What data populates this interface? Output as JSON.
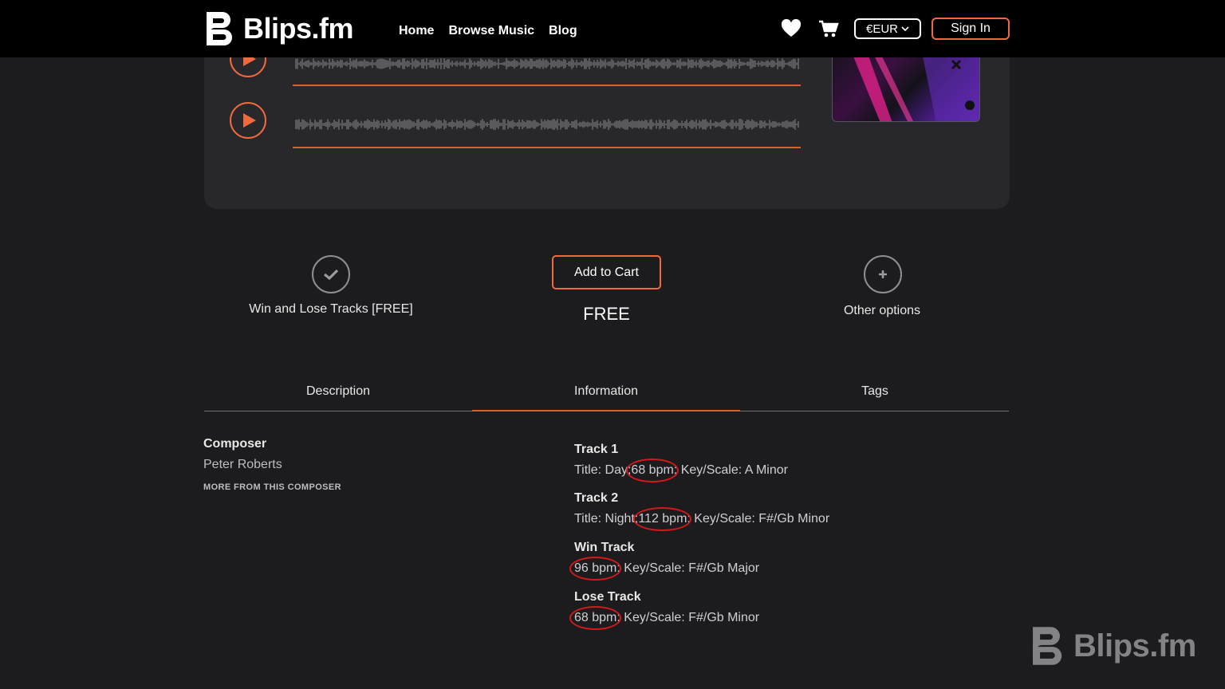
{
  "header": {
    "logo_text": "Blips.fm",
    "nav": [
      "Home",
      "Browse Music",
      "Blog"
    ],
    "currency": "€EUR",
    "signin_label": "Sign In"
  },
  "options": {
    "selected_label": "Win and Lose Tracks [FREE]",
    "add_to_cart_label": "Add to Cart",
    "price": "FREE",
    "other_label": "Other options"
  },
  "tabs": [
    "Description",
    "Information",
    "Tags"
  ],
  "composer": {
    "heading": "Composer",
    "name": "Peter Roberts",
    "more_link": "MORE FROM THIS COMPOSER"
  },
  "tracks": [
    {
      "title": "Track 1",
      "prefix": "Title: Day;",
      "bpm": "68 bpm",
      "suffix": "; Key/Scale: A Minor"
    },
    {
      "title": "Track 2",
      "prefix": "Title: Night;",
      "bpm": "112 bpm",
      "suffix": "; Key/Scale: F#/Gb Minor"
    },
    {
      "title": "Win Track",
      "prefix": "",
      "bpm": "96 bpm",
      "suffix": "; Key/Scale: F#/Gb Major"
    },
    {
      "title": "Lose Track",
      "prefix": "",
      "bpm": "68 bpm",
      "suffix": "; Key/Scale: F#/Gb Minor"
    }
  ],
  "watermark": "Blips.fm",
  "colors": {
    "accent": "#f06a3e",
    "annotation": "#d11a1a",
    "background": "#1c1c1f",
    "card": "#28272b"
  }
}
